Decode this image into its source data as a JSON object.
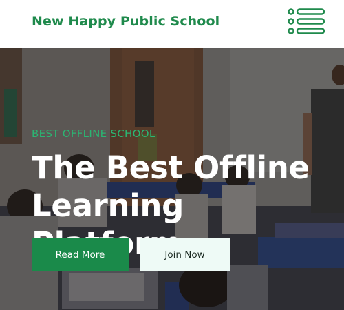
{
  "header": {
    "brand": "New Happy Public School",
    "menu_icon": "list-menu-icon"
  },
  "hero": {
    "eyebrow": "BEST OFFLINE SCHOOL",
    "headline_line1": "The Best Offline",
    "headline_line2": "Learning Platform",
    "primary_button": "Read More",
    "secondary_button": "Join Now"
  },
  "colors": {
    "brand_green": "#1f8a4c",
    "accent_green": "#2bb673",
    "button_green": "#1a8a4a",
    "button_light": "#eefaf6"
  }
}
